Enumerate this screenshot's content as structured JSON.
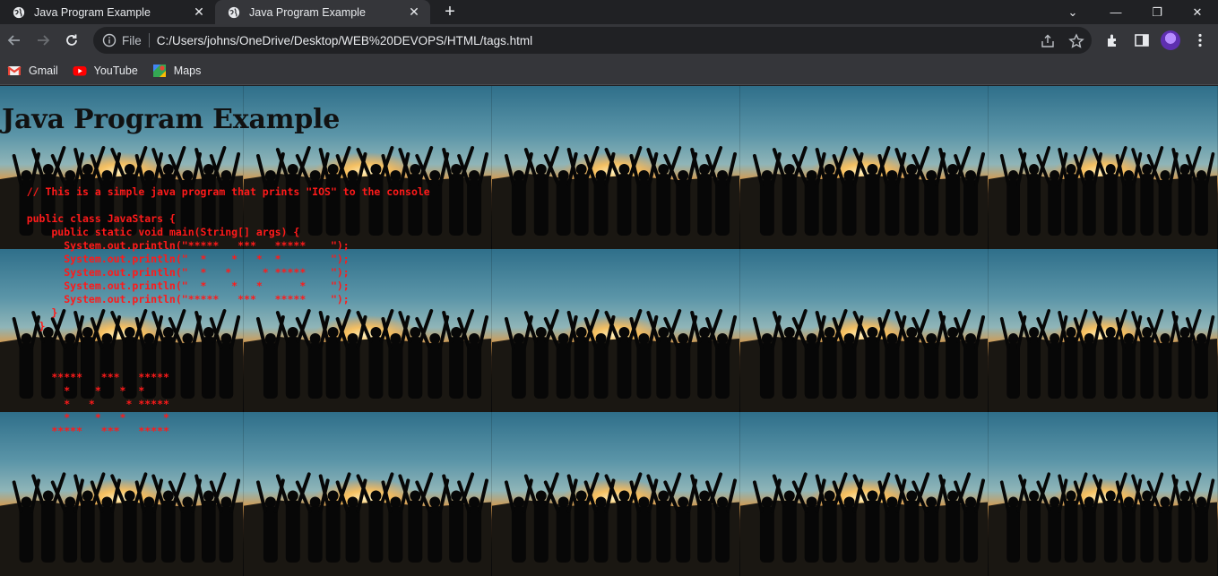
{
  "browser": {
    "tabs": [
      {
        "title": "Java Program Example",
        "active": false
      },
      {
        "title": "Java Program Example",
        "active": true
      }
    ],
    "address": {
      "scheme_label": "File",
      "url": "C:/Users/johns/OneDrive/Desktop/WEB%20DEVOPS/HTML/tags.html"
    },
    "bookmarks": [
      {
        "label": "Gmail",
        "icon": "gmail-icon"
      },
      {
        "label": "YouTube",
        "icon": "youtube-icon"
      },
      {
        "label": "Maps",
        "icon": "maps-icon"
      }
    ]
  },
  "page": {
    "heading": "Java Program Example",
    "code": "\n    // This is a simple java program that prints \"IOS\" to the console\n\n    public class JavaStars {\n        public static void main(String[] args) {\n          System.out.println(\"*****   ***   *****    \");\n          System.out.println(\"  *    *   *  *        \");\n          System.out.println(\"  *   *     * *****    \");\n          System.out.println(\"  *    *   *      *    \");\n          System.out.println(\"*****   ***   *****    \");\n        }\n      }",
    "output": "\n        *****   ***   *****\n          *    *   *  *\n          *   *     * *****\n          *    *   *      *\n        *****   ***   *****",
    "background": "sunset silhouette crowd photo, tiled"
  },
  "colors": {
    "code_text": "#ff1a1a",
    "chrome_dark": "#202124",
    "chrome_mid": "#35363a"
  }
}
